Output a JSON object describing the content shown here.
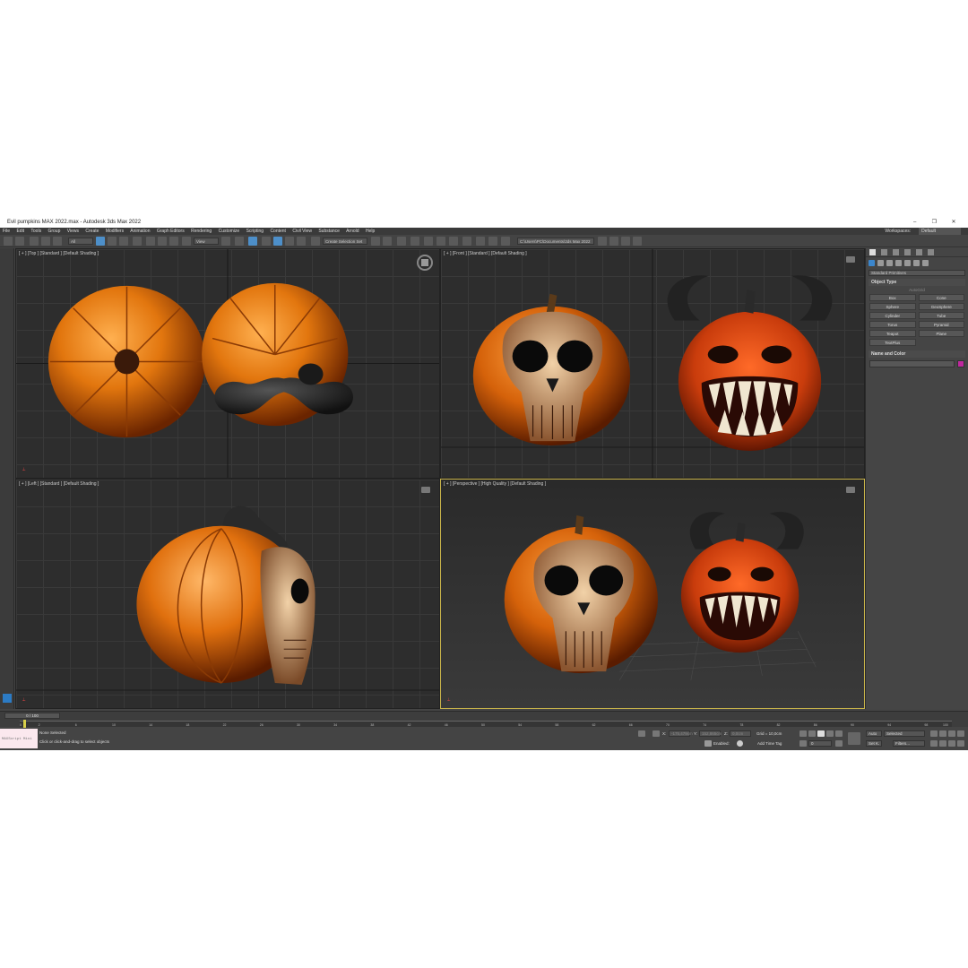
{
  "window": {
    "title": "Evil pumpkins MAX 2022.max - Autodesk 3ds Max 2022",
    "controls": [
      "–",
      "❐",
      "✕"
    ]
  },
  "menu": {
    "items": [
      "File",
      "Edit",
      "Tools",
      "Group",
      "Views",
      "Create",
      "Modifiers",
      "Animation",
      "Graph Editors",
      "Rendering",
      "Customize",
      "Scripting",
      "Content",
      "Civil View",
      "Substance",
      "Arnold",
      "Help"
    ],
    "workspace_label": "Workspaces:",
    "workspace_value": "Default"
  },
  "toolbar": {
    "filter_all": "All",
    "view_dropdown": "View",
    "selection_set": "Create Selection Set",
    "path": "C:\\Users\\PC\\Documents\\3ds Max 2022"
  },
  "viewports": {
    "top": {
      "label": "[ + ] [Top ] [Standard ] [Default Shading ]"
    },
    "front": {
      "label": "[ + ] [Front ] [Standard ] [Default Shading ]"
    },
    "left": {
      "label": "[ + ] [Left ] [Standard ] [Default Shading ]"
    },
    "perspective": {
      "label": "[ + ] [Perspective ] [High Quality ] [Default Shading ]"
    }
  },
  "command_panel": {
    "category": "Standard Primitives",
    "object_type_title": "Object Type",
    "autogrid": "AutoGrid",
    "primitives": [
      "Box",
      "Cone",
      "Sphere",
      "GeoSphere",
      "Cylinder",
      "Tube",
      "Torus",
      "Pyramid",
      "Teapot",
      "Plane",
      "TextPlus"
    ],
    "name_color_title": "Name and Color",
    "object_color": "#c0289f"
  },
  "timeline": {
    "frame_display": "0 / 100",
    "ticks": [
      "0",
      "2",
      "6",
      "10",
      "14",
      "18",
      "22",
      "26",
      "30",
      "34",
      "38",
      "42",
      "46",
      "50",
      "54",
      "58",
      "62",
      "66",
      "70",
      "74",
      "78",
      "82",
      "86",
      "90",
      "94",
      "98",
      "100"
    ],
    "current_frame": 0
  },
  "status": {
    "maxscript": "MAXScript Mini",
    "selection": "None Selected",
    "prompt": "Click or click-and-drag to select objects",
    "x_label": "X:",
    "x_value": "-175,479cm",
    "y_label": "Y:",
    "y_value": "152,865cm",
    "z_label": "Z:",
    "z_value": "0,0cm",
    "grid": "Grid = 10,0cm",
    "enabled": "Enabled:",
    "add_time_tag": "Add Time Tag",
    "auto": "Auto",
    "set_k": "Set K.",
    "key_dropdown": "Selected",
    "filters": "Filters...",
    "frame_field": "0"
  }
}
